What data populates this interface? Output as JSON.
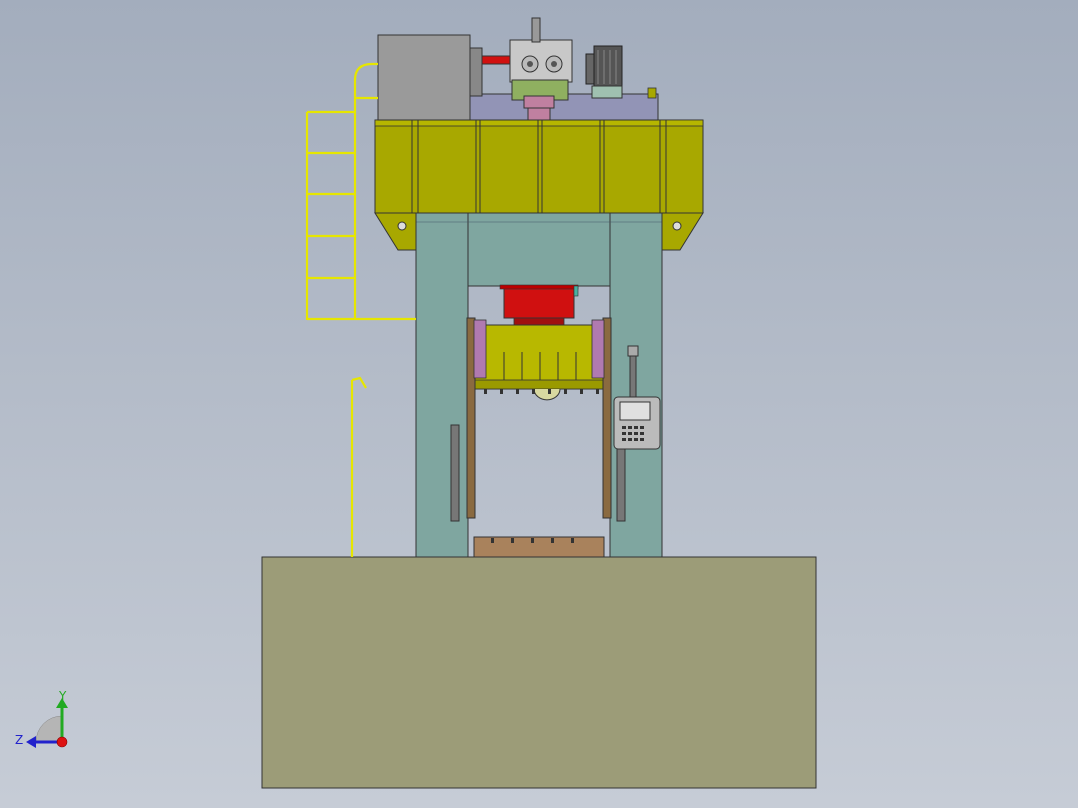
{
  "viewport": {
    "background_top": "#a3adbd",
    "background_bottom": "#c6ccd6"
  },
  "triad": {
    "y_label": "Y",
    "z_label": "Z",
    "y_color": "#22aa22",
    "z_color": "#2222cc",
    "x_color": "#dd1111"
  },
  "colors": {
    "crown": "#a8a800",
    "column": "#7fa6a0",
    "foundation": "#9c9c78",
    "ladder": "#e6e600",
    "cylinder": "#d01010",
    "slide": "#b8b800",
    "guide_purple": "#b07ab0",
    "tank": "#9a9a9a",
    "bolster": "#a9825c"
  }
}
